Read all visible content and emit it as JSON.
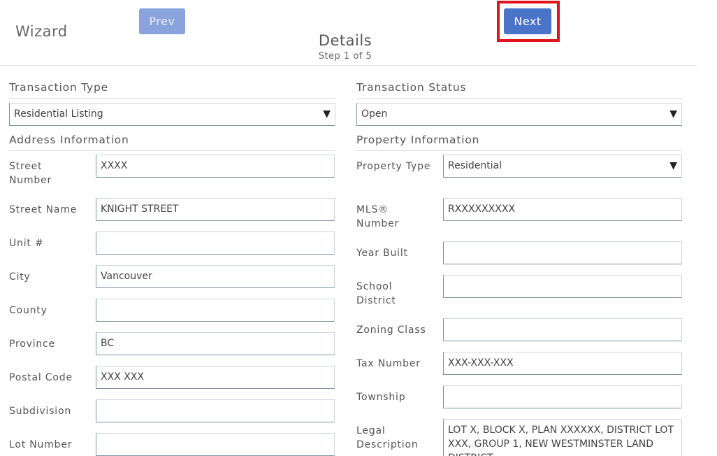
{
  "header": {
    "wizard_title": "Wizard",
    "prev_label": "Prev",
    "next_label": "Next",
    "step_title": "Details",
    "step_sub": "Step 1 of 5"
  },
  "left": {
    "transaction_type_heading": "Transaction Type",
    "transaction_type_value": "Residential Listing",
    "address_heading": "Address Information",
    "fields": [
      {
        "label": "Street Number",
        "value": "XXXX"
      },
      {
        "label": "Street Name",
        "value": "KNIGHT STREET"
      },
      {
        "label": "Unit #",
        "value": ""
      },
      {
        "label": "City",
        "value": "Vancouver"
      },
      {
        "label": "County",
        "value": ""
      },
      {
        "label": "Province",
        "value": "BC"
      },
      {
        "label": "Postal Code",
        "value": "XXX XXX"
      },
      {
        "label": "Subdivision",
        "value": ""
      },
      {
        "label": "Lot Number",
        "value": ""
      }
    ]
  },
  "right": {
    "transaction_status_heading": "Transaction Status",
    "transaction_status_value": "Open",
    "property_heading": "Property Information",
    "property_type_label": "Property Type",
    "property_type_value": "Residential",
    "fields": [
      {
        "label": "MLS® Number",
        "value": "RXXXXXXXXX"
      },
      {
        "label": "Year Built",
        "value": ""
      },
      {
        "label": "School District",
        "value": ""
      },
      {
        "label": "Zoning Class",
        "value": ""
      },
      {
        "label": "Tax Number",
        "value": "XXX-XXX-XXX"
      },
      {
        "label": "Township",
        "value": ""
      },
      {
        "label": "Legal Description",
        "value": "LOT X, BLOCK X, PLAN XXXXXX, DISTRICT LOT XXX, GROUP 1, NEW WESTMINSTER LAND DISTRICT"
      }
    ]
  },
  "icons": {
    "dropdown_caret": "▼"
  },
  "colors": {
    "primary": "#4a74c9",
    "disabled": "#8aa3dc",
    "highlight": "#e0141e"
  }
}
